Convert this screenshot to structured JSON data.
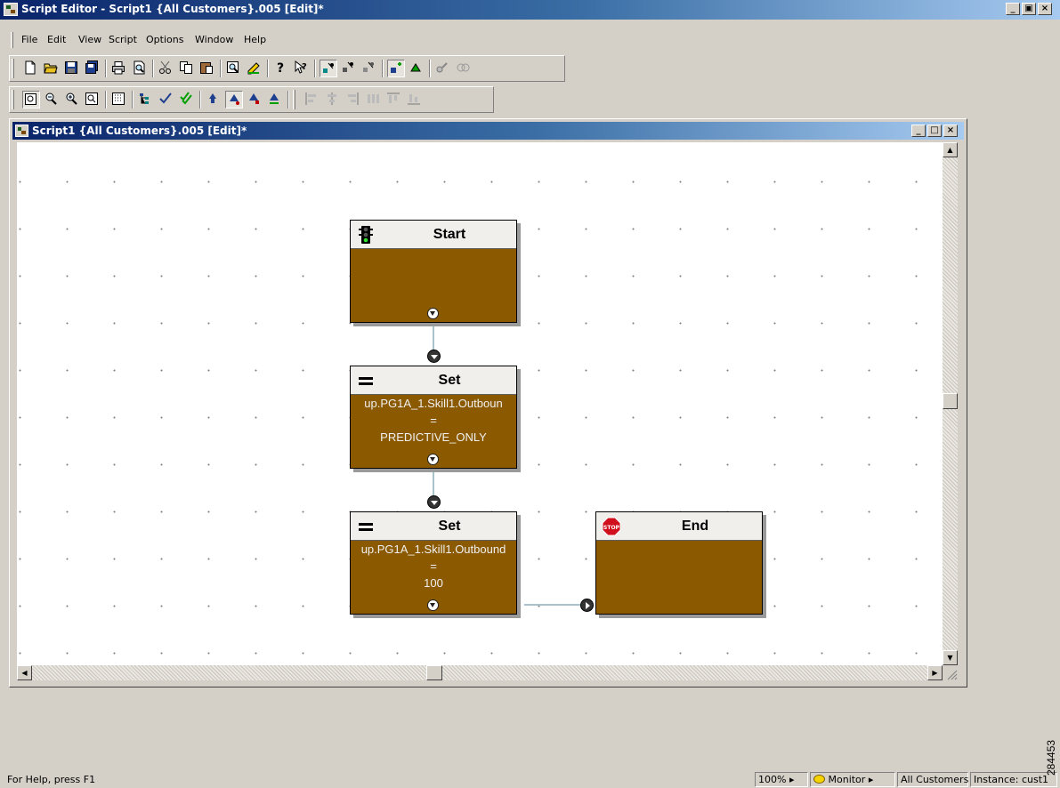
{
  "app": {
    "title": "Script Editor - Script1 {All Customers}.005 [Edit]*"
  },
  "menubar": {
    "items": [
      "File",
      "Edit",
      "View",
      "Script",
      "Options",
      "Window",
      "Help"
    ]
  },
  "toolbar1": {
    "buttons": [
      "new-icon",
      "open-icon",
      "save-icon",
      "save-all-icon",
      "print-icon",
      "print-preview-icon",
      "cut-icon",
      "copy-icon",
      "paste-icon",
      "find-icon",
      "properties-icon",
      "help-icon",
      "context-help-icon",
      "select-icon",
      "browse-icon",
      "quick-edit-icon",
      "edit-mode-icon",
      "monitor-icon",
      "connect-icon",
      "disconnect-icon"
    ]
  },
  "toolbar2": {
    "buttons": [
      "zoom-fit-icon",
      "zoom-out-icon",
      "zoom-in-icon",
      "zoom-window-icon",
      "grid-icon",
      "tree-icon",
      "validate-icon",
      "validate-all-icon",
      "route-icon",
      "target-icon",
      "select-target-icon",
      "queue-icon",
      "align-left-icon",
      "align-center-icon",
      "align-right-icon",
      "space-horizontal-icon",
      "align-top-icon",
      "align-bottom-icon"
    ]
  },
  "document": {
    "title": "Script1 {All Customers}.005 [Edit]*"
  },
  "nodes": {
    "start": {
      "title": "Start"
    },
    "set1": {
      "title": "Set",
      "variable": "up.PG1A_1.Skill1.Outboun",
      "operator": "=",
      "value": "PREDICTIVE_ONLY"
    },
    "set2": {
      "title": "Set",
      "variable": "up.PG1A_1.Skill1.Outbound",
      "operator": "=",
      "value": "100"
    },
    "end": {
      "title": "End"
    }
  },
  "colors": {
    "node_body": "#8b5a00",
    "connector": "#a7c3cc",
    "title_bar_start": "#0a246a",
    "title_bar_end": "#a6caf0"
  },
  "status": {
    "help": "For Help, press F1",
    "zoom": "100%",
    "mode": "Monitor",
    "customer": "All Customers",
    "instance": "Instance: cust1"
  },
  "figure_id": "284453"
}
